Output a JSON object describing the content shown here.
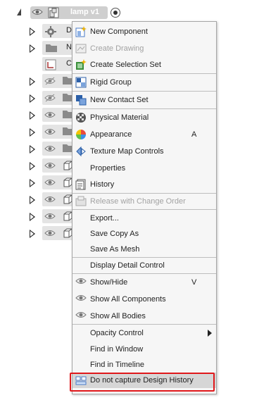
{
  "root": {
    "label": "lamp v1"
  },
  "tree_rows": [
    {
      "label": "De",
      "icon": "gear-icon"
    },
    {
      "label": "Na",
      "icon": "folder-icon"
    },
    {
      "label": "Co",
      "icon": "origin-icon"
    },
    {
      "label": "",
      "icon": "folder-icon"
    },
    {
      "label": "",
      "icon": "folder-icon"
    },
    {
      "label": "",
      "icon": "folder-icon"
    },
    {
      "label": "",
      "icon": "folder-icon"
    },
    {
      "label": "",
      "icon": "folder-icon"
    },
    {
      "label": "",
      "icon": "body-icon"
    },
    {
      "label": "",
      "icon": "body-icon"
    },
    {
      "label": "",
      "icon": "body-icon"
    },
    {
      "label": "",
      "icon": "body-icon"
    },
    {
      "label": "",
      "icon": "body-icon"
    }
  ],
  "menu": {
    "items": [
      {
        "label": "New Component",
        "icon": "new-component-icon",
        "disabled": false
      },
      {
        "label": "Create Drawing",
        "icon": "create-drawing-icon",
        "disabled": true
      },
      {
        "label": "Create Selection Set",
        "icon": "selection-set-icon",
        "disabled": false
      },
      {
        "label": "Rigid Group",
        "icon": "rigid-group-icon",
        "disabled": false
      },
      {
        "label": "New Contact Set",
        "icon": "contact-set-icon",
        "disabled": false
      },
      {
        "label": "Physical Material",
        "icon": "physical-material-icon",
        "disabled": false
      },
      {
        "label": "Appearance",
        "icon": "appearance-icon",
        "shortcut": "A",
        "disabled": false
      },
      {
        "label": "Texture Map Controls",
        "icon": "texture-map-icon",
        "disabled": false
      },
      {
        "label": "Properties",
        "icon": "",
        "disabled": false
      },
      {
        "label": "History",
        "icon": "history-icon",
        "disabled": false
      },
      {
        "label": "Release with Change Order",
        "icon": "release-icon",
        "disabled": true
      },
      {
        "label": "Export...",
        "icon": "",
        "disabled": false
      },
      {
        "label": "Save Copy As",
        "icon": "",
        "disabled": false
      },
      {
        "label": "Save As Mesh",
        "icon": "",
        "disabled": false
      },
      {
        "label": "Display Detail Control",
        "icon": "",
        "disabled": false
      },
      {
        "label": "Show/Hide",
        "icon": "eye-icon",
        "shortcut": "V",
        "disabled": false
      },
      {
        "label": "Show All Components",
        "icon": "eye-icon",
        "disabled": false
      },
      {
        "label": "Show All Bodies",
        "icon": "eye-icon",
        "disabled": false
      },
      {
        "label": "Opacity Control",
        "icon": "",
        "disabled": false,
        "submenu": true
      },
      {
        "label": "Find in Window",
        "icon": "",
        "disabled": false
      },
      {
        "label": "Find in Timeline",
        "icon": "",
        "disabled": false
      },
      {
        "label": "Do not capture Design History",
        "icon": "design-history-icon",
        "disabled": false
      }
    ]
  },
  "colors": {
    "highlight_border": "#e0181b",
    "menu_bg": "#f6f6f6",
    "disabled_text": "#a2a2a2"
  }
}
